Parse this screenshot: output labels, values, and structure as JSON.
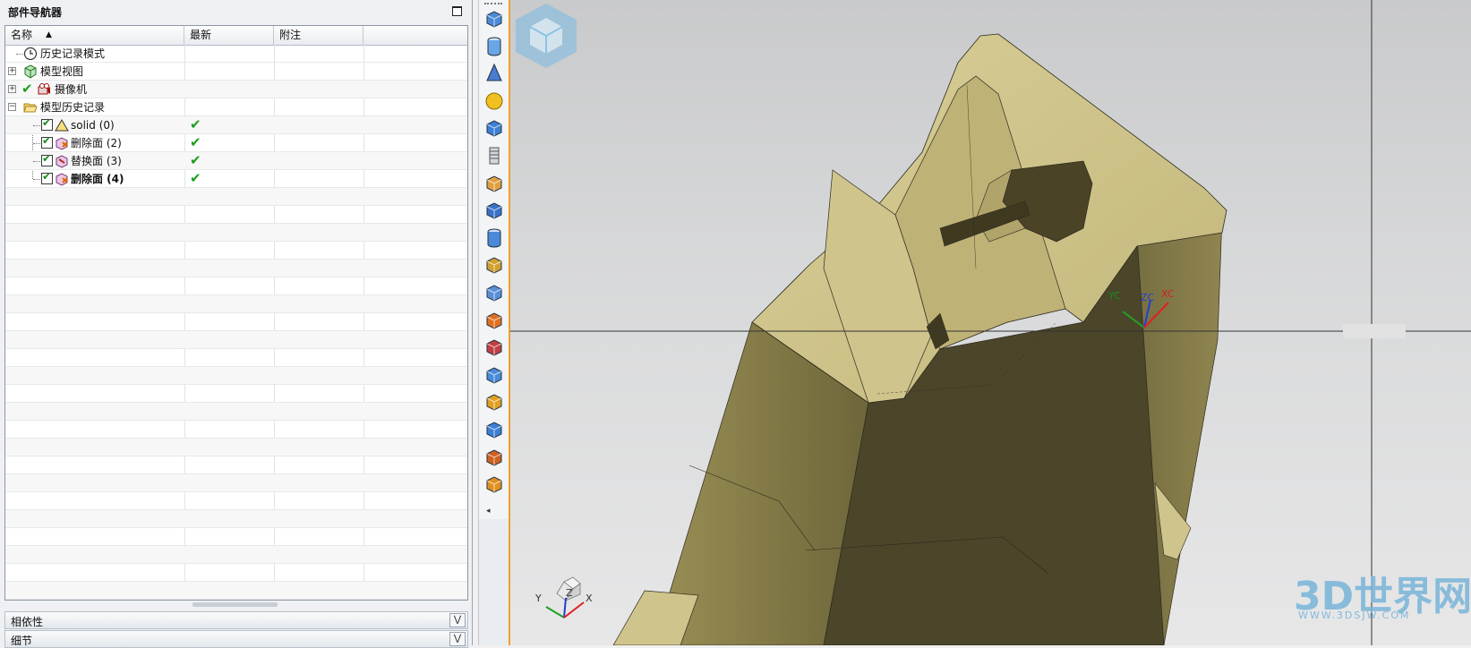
{
  "navigator": {
    "title": "部件导航器",
    "columns": {
      "name": "名称",
      "latest": "最新",
      "comment": "附注"
    },
    "items": [
      {
        "label": "历史记录模式",
        "latest": ""
      },
      {
        "label": "模型视图",
        "latest": ""
      },
      {
        "label": "摄像机",
        "latest": ""
      },
      {
        "label": "模型历史记录",
        "latest": ""
      },
      {
        "label": "solid (0)",
        "latest": "✔"
      },
      {
        "label": "删除面 (2)",
        "latest": "✔"
      },
      {
        "label": "替换面 (3)",
        "latest": "✔"
      },
      {
        "label": "删除面 (4)",
        "latest": "✔"
      }
    ],
    "sections": {
      "dependencies": "相依性",
      "details": "细节"
    }
  },
  "toolbar": {
    "icons": [
      "block-icon",
      "cylinder-icon",
      "cone-icon",
      "sphere-icon",
      "boss-icon",
      "thread-icon",
      "pad-icon",
      "pocket-icon",
      "hole-icon",
      "slot-icon",
      "tube-icon",
      "emboss-icon",
      "sketch-feature-icon",
      "extract-bodies-icon",
      "unite-icon",
      "subtract-icon",
      "offset-surface-icon",
      "move-face-icon"
    ]
  },
  "viewport": {
    "wcs_labels": {
      "xc": "XC",
      "yc": "YC",
      "zc": "ZC"
    },
    "triad_labels": {
      "x": "X",
      "y": "Y",
      "z": "Z"
    },
    "watermark": {
      "title": "3D世界网",
      "url": "WWW.3DSJW.COM"
    },
    "model_color": "#c8bd84",
    "background_color": "#d2d3d4"
  }
}
